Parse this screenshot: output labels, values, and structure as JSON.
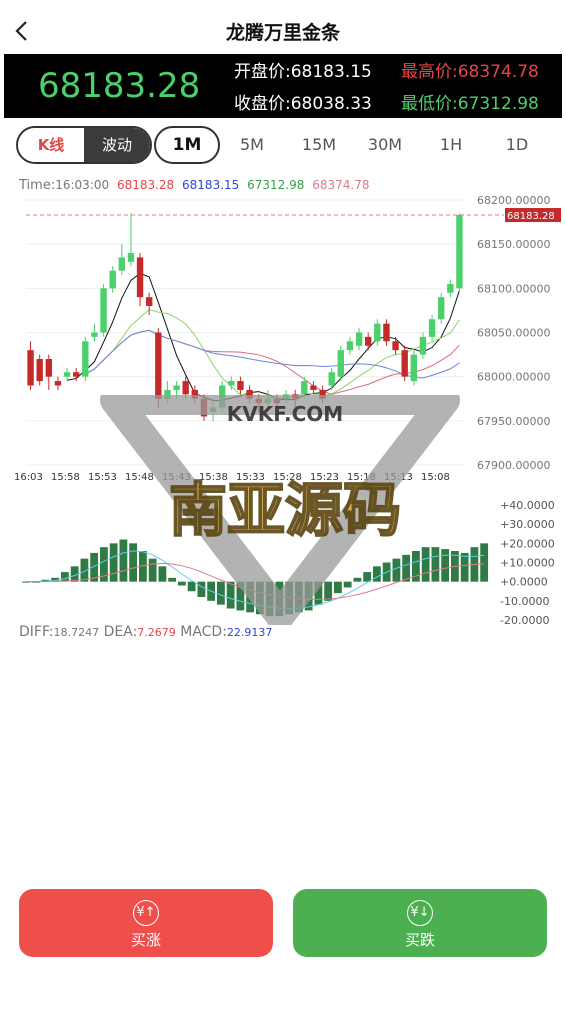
{
  "header": {
    "title": "龙腾万里金条"
  },
  "quote": {
    "last": "68183.28",
    "open_label": "开盘价:",
    "open": "68183.15",
    "high_label": "最高价:",
    "high": "68374.78",
    "close_label": "收盘价:",
    "close": "68038.33",
    "low_label": "最低价:",
    "low": "67312.98"
  },
  "tabs": {
    "kline": "K线",
    "wave": "波动",
    "periods": [
      "1M",
      "5M",
      "15M",
      "30M",
      "1H",
      "1D"
    ],
    "active": "1M"
  },
  "info": {
    "time_label": "Time:",
    "time": "16:03:00",
    "v1": "68183.28",
    "v2": "68183.15",
    "v3": "67312.98",
    "v4": "68374.78"
  },
  "colors": {
    "up": "#4bd06b",
    "down": "#c42a2a",
    "accent_red": "#e64545",
    "accent_green": "#4caf50"
  },
  "chart_data": [
    {
      "type": "candlestick",
      "y_ticks": [
        "68200.00000",
        "68150.00000",
        "68100.00000",
        "68050.00000",
        "68000.00000",
        "67950.00000",
        "67900.00000"
      ],
      "ylim": [
        67900,
        68200
      ],
      "x_ticks": [
        "16:03",
        "15:58",
        "15:53",
        "15:48",
        "15:43",
        "15:38",
        "15:33",
        "15:28",
        "15:23",
        "15:18",
        "15:13",
        "15:08"
      ],
      "current_price_tag": "68183.28",
      "candles": [
        {
          "o": 68030,
          "c": 67990,
          "h": 68040,
          "l": 67985
        },
        {
          "o": 68020,
          "c": 67995,
          "h": 68025,
          "l": 67990
        },
        {
          "o": 68020,
          "c": 68000,
          "h": 68025,
          "l": 67985
        },
        {
          "o": 67995,
          "c": 67990,
          "h": 68000,
          "l": 67985
        },
        {
          "o": 68000,
          "c": 68005,
          "h": 68010,
          "l": 67995
        },
        {
          "o": 68005,
          "c": 68000,
          "h": 68010,
          "l": 67995
        },
        {
          "o": 68000,
          "c": 68040,
          "h": 68045,
          "l": 67995
        },
        {
          "o": 68045,
          "c": 68050,
          "h": 68060,
          "l": 68040
        },
        {
          "o": 68050,
          "c": 68100,
          "h": 68105,
          "l": 68045
        },
        {
          "o": 68100,
          "c": 68120,
          "h": 68125,
          "l": 68095
        },
        {
          "o": 68120,
          "c": 68135,
          "h": 68150,
          "l": 68115
        },
        {
          "o": 68130,
          "c": 68140,
          "h": 68185,
          "l": 68125
        },
        {
          "o": 68135,
          "c": 68090,
          "h": 68140,
          "l": 68080
        },
        {
          "o": 68090,
          "c": 68080,
          "h": 68095,
          "l": 68070
        },
        {
          "o": 68050,
          "c": 67975,
          "h": 68055,
          "l": 67965
        },
        {
          "o": 67975,
          "c": 67985,
          "h": 67995,
          "l": 67970
        },
        {
          "o": 67985,
          "c": 67990,
          "h": 67995,
          "l": 67975
        },
        {
          "o": 67995,
          "c": 67980,
          "h": 68000,
          "l": 67975
        },
        {
          "o": 67985,
          "c": 67975,
          "h": 67990,
          "l": 67970
        },
        {
          "o": 67975,
          "c": 67955,
          "h": 67980,
          "l": 67950
        },
        {
          "o": 67960,
          "c": 67965,
          "h": 67975,
          "l": 67950
        },
        {
          "o": 67965,
          "c": 67990,
          "h": 67995,
          "l": 67960
        },
        {
          "o": 67990,
          "c": 67995,
          "h": 68000,
          "l": 67985
        },
        {
          "o": 67995,
          "c": 67985,
          "h": 68000,
          "l": 67980
        },
        {
          "o": 67985,
          "c": 67975,
          "h": 67990,
          "l": 67970
        },
        {
          "o": 67975,
          "c": 67970,
          "h": 67980,
          "l": 67960
        },
        {
          "o": 67970,
          "c": 67975,
          "h": 67985,
          "l": 67965
        },
        {
          "o": 67975,
          "c": 67970,
          "h": 67980,
          "l": 67965
        },
        {
          "o": 67975,
          "c": 67980,
          "h": 67985,
          "l": 67970
        },
        {
          "o": 67980,
          "c": 67975,
          "h": 67985,
          "l": 67965
        },
        {
          "o": 67980,
          "c": 67995,
          "h": 68000,
          "l": 67975
        },
        {
          "o": 67990,
          "c": 67985,
          "h": 67995,
          "l": 67980
        },
        {
          "o": 67985,
          "c": 67975,
          "h": 67990,
          "l": 67970
        },
        {
          "o": 67990,
          "c": 68005,
          "h": 68010,
          "l": 67985
        },
        {
          "o": 68000,
          "c": 68030,
          "h": 68035,
          "l": 67995
        },
        {
          "o": 68030,
          "c": 68040,
          "h": 68045,
          "l": 68025
        },
        {
          "o": 68035,
          "c": 68050,
          "h": 68055,
          "l": 68030
        },
        {
          "o": 68045,
          "c": 68035,
          "h": 68050,
          "l": 68030
        },
        {
          "o": 68040,
          "c": 68060,
          "h": 68065,
          "l": 68035
        },
        {
          "o": 68060,
          "c": 68040,
          "h": 68065,
          "l": 68035
        },
        {
          "o": 68040,
          "c": 68030,
          "h": 68045,
          "l": 68025
        },
        {
          "o": 68030,
          "c": 68000,
          "h": 68035,
          "l": 67995
        },
        {
          "o": 67995,
          "c": 68025,
          "h": 68030,
          "l": 67990
        },
        {
          "o": 68025,
          "c": 68045,
          "h": 68050,
          "l": 68020
        },
        {
          "o": 68045,
          "c": 68065,
          "h": 68070,
          "l": 68040
        },
        {
          "o": 68065,
          "c": 68090,
          "h": 68095,
          "l": 68060
        },
        {
          "o": 68095,
          "c": 68105,
          "h": 68110,
          "l": 68090
        },
        {
          "o": 68100,
          "c": 68183,
          "h": 68185,
          "l": 68095
        }
      ]
    },
    {
      "type": "bar",
      "name": "MACD",
      "y_ticks": [
        "+40.0000",
        "+30.0000",
        "+20.0000",
        "+10.0000",
        "+0.0000",
        "-10.0000",
        "-20.0000"
      ],
      "ylim": [
        -20,
        40
      ],
      "values": [
        0,
        0,
        1,
        2,
        5,
        8,
        12,
        15,
        18,
        20,
        22,
        20,
        16,
        12,
        8,
        2,
        -2,
        -5,
        -8,
        -10,
        -12,
        -14,
        -15,
        -16,
        -17,
        -18,
        -18,
        -17,
        -16,
        -15,
        -12,
        -10,
        -6,
        -3,
        2,
        5,
        8,
        10,
        12,
        14,
        16,
        18,
        18,
        17,
        16,
        15,
        18,
        20
      ]
    }
  ],
  "indicator": {
    "diff_label": "DIFF:",
    "diff": "18.7247",
    "dea_label": "DEA:",
    "dea": "7.2679",
    "macd_label": "MACD:",
    "macd": "22.9137"
  },
  "actions": {
    "buy_up": "买涨",
    "buy_down": "买跌",
    "up_icon": "yuan-up-icon",
    "down_icon": "yuan-down-icon"
  },
  "watermark": {
    "text": "南亚源码",
    "site": "KVKF.COM"
  }
}
